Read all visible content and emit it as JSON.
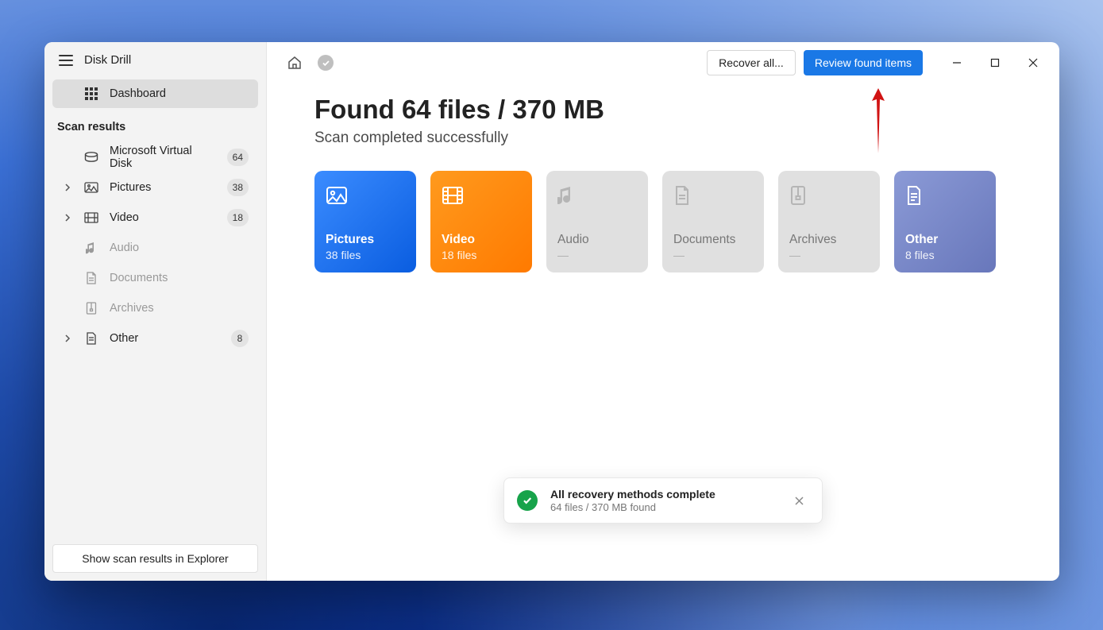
{
  "app": {
    "title": "Disk Drill"
  },
  "sidebar": {
    "dashboard": "Dashboard",
    "section_label": "Scan results",
    "items": [
      {
        "label": "Microsoft Virtual Disk",
        "count": "64"
      },
      {
        "label": "Pictures",
        "count": "38"
      },
      {
        "label": "Video",
        "count": "18"
      },
      {
        "label": "Audio",
        "count": ""
      },
      {
        "label": "Documents",
        "count": ""
      },
      {
        "label": "Archives",
        "count": ""
      },
      {
        "label": "Other",
        "count": "8"
      }
    ],
    "footer_button": "Show scan results in Explorer"
  },
  "toolbar": {
    "recover_all": "Recover all...",
    "review": "Review found items"
  },
  "results": {
    "headline": "Found 64 files / 370 MB",
    "subheading": "Scan completed successfully",
    "cards": {
      "pictures": {
        "title": "Pictures",
        "sub": "38 files"
      },
      "video": {
        "title": "Video",
        "sub": "18 files"
      },
      "audio": {
        "title": "Audio",
        "sub": "—"
      },
      "documents": {
        "title": "Documents",
        "sub": "—"
      },
      "archives": {
        "title": "Archives",
        "sub": "—"
      },
      "other": {
        "title": "Other",
        "sub": "8 files"
      }
    }
  },
  "toast": {
    "title": "All recovery methods complete",
    "sub": "64 files / 370 MB found"
  }
}
